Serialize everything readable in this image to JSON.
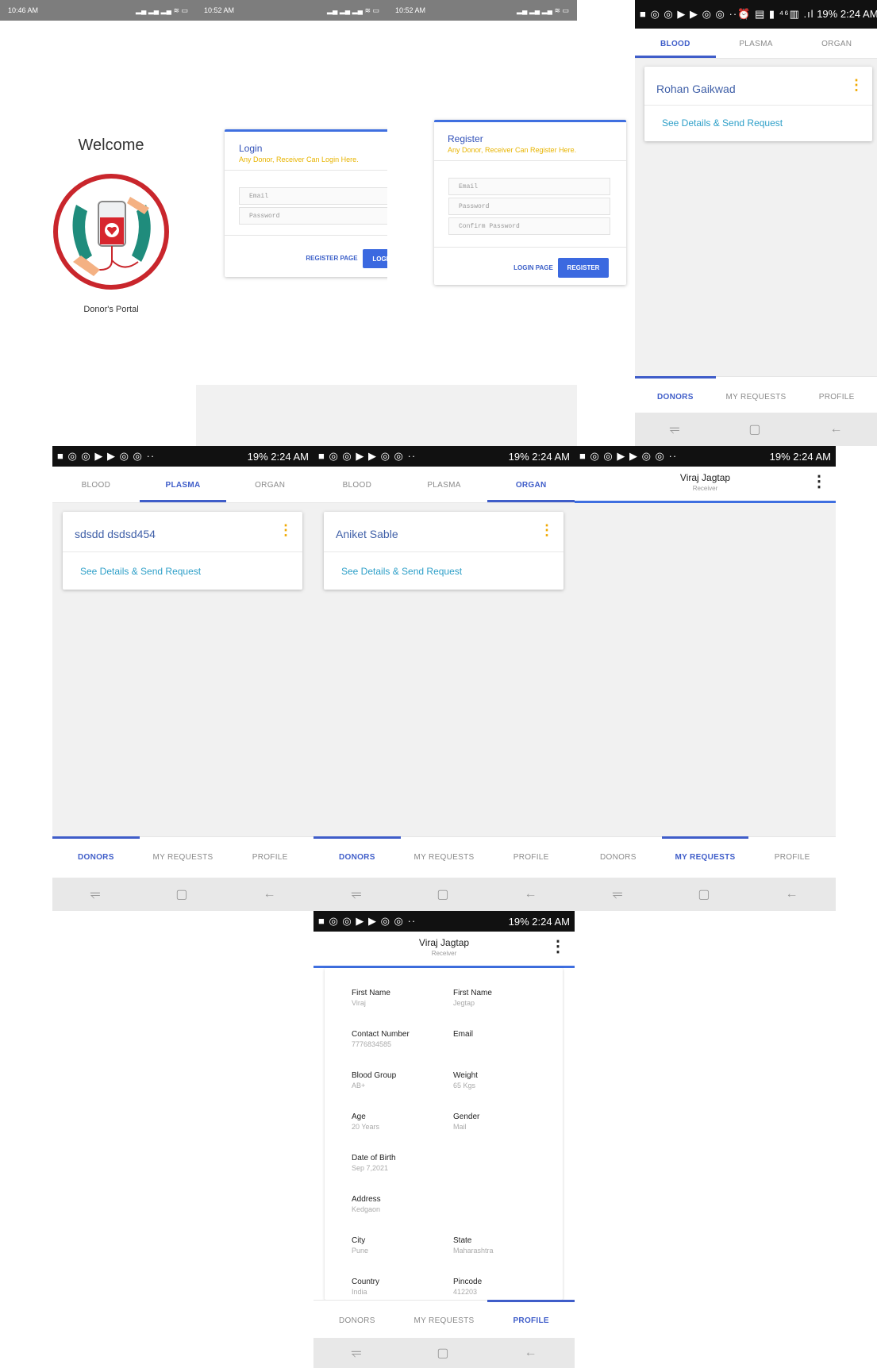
{
  "status_light": [
    {
      "time": "10:46 AM",
      "icons": "∩ ◘ ↻",
      "right": "▂▄ ▂▄ ▂▄ ≋ ▭"
    },
    {
      "time": "10:52 AM",
      "icons": "∩ ◘ ↻",
      "right": "▂▄ ▂▄ ▂▄ ≋ ▭"
    },
    {
      "time": "10:52 AM",
      "icons": "∩ ◘ ↻",
      "right": "▂▄ ▂▄ ▂▄ ≋ ▭"
    }
  ],
  "status_dark": {
    "icons": "■ ◎ ◎ ▶ ▶ ◎ ◎ ··",
    "right_icons": "⏰ ▤ ▮ ⁴⁶▥ .ıl",
    "battery": "19%",
    "time": "2:24 AM"
  },
  "welcome": {
    "title": "Welcome",
    "subtitle": "Donor's Portal"
  },
  "login": {
    "title": "Login",
    "subtitle": "Any Donor, Receiver Can Login Here.",
    "email_placeholder": "Email",
    "password_placeholder": "Password",
    "secondary_button": "REGISTER PAGE",
    "primary_button": "LOGIN"
  },
  "register": {
    "title": "Register",
    "subtitle": "Any Donor, Receiver Can Register Here.",
    "email_placeholder": "Email",
    "password_placeholder": "Password",
    "confirm_placeholder": "Confirm Password",
    "secondary_button": "LOGIN PAGE",
    "primary_button": "REGISTER"
  },
  "top_tabs": [
    "BLOOD",
    "PLASMA",
    "ORGAN"
  ],
  "bottom_tabs": [
    "DONORS",
    "MY REQUESTS",
    "PROFILE"
  ],
  "nav_icons": [
    "⥫",
    "▢",
    "←"
  ],
  "donors": {
    "blood": {
      "name": "Rohan Gaikwad",
      "link": "See Details & Send Request"
    },
    "plasma": {
      "name": "sdsdd dsdsd454",
      "link": "See Details & Send Request"
    },
    "organ": {
      "name": "Aniket  Sable",
      "link": "See Details & Send Request"
    }
  },
  "user": {
    "name": "Viraj  Jagtap",
    "role": "Receiver"
  },
  "profile": [
    [
      {
        "label": "First Name",
        "value": "Viraj"
      },
      {
        "label": "First Name",
        "value": "Jegtap"
      }
    ],
    [
      {
        "label": "Contact Number",
        "value": "7776834585"
      },
      {
        "label": "Email",
        "value": ""
      }
    ],
    [
      {
        "label": "Blood Group",
        "value": "AB+"
      },
      {
        "label": "Weight",
        "value": "65 Kgs"
      }
    ],
    [
      {
        "label": "Age",
        "value": "20 Years"
      },
      {
        "label": "Gender",
        "value": "Mail"
      }
    ],
    [
      {
        "label": "Date of Birth",
        "value": "Sep 7,2021"
      },
      {
        "label": "",
        "value": ""
      }
    ],
    [
      {
        "label": "Address",
        "value": "Kedgaon"
      },
      {
        "label": "",
        "value": ""
      }
    ],
    [
      {
        "label": "City",
        "value": "Pune"
      },
      {
        "label": "State",
        "value": "Maharashtra"
      }
    ],
    [
      {
        "label": "Country",
        "value": "India"
      },
      {
        "label": "Pincode",
        "value": "412203"
      }
    ]
  ],
  "colors": {
    "accent": "#3f5dc9",
    "link": "#2d9fc8",
    "kebab": "#f0a800",
    "subtitle_yellow": "#e8b400"
  }
}
